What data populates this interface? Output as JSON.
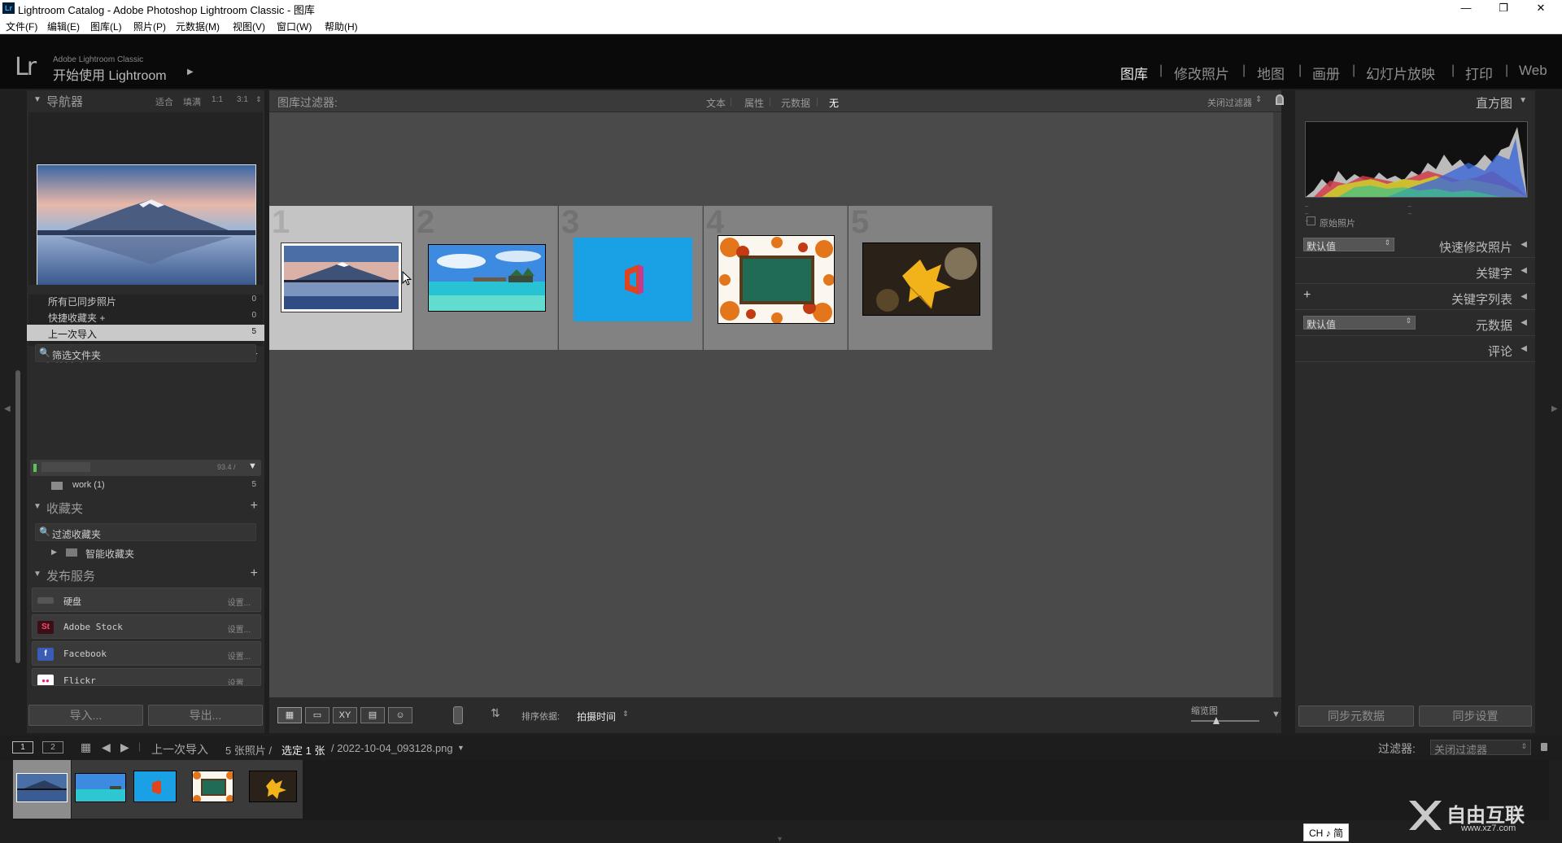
{
  "window": {
    "title": "Lightroom Catalog - Adobe Photoshop Lightroom Classic - 图库",
    "app_icon": "Lr"
  },
  "menu": [
    "文件(F)",
    "编辑(E)",
    "图库(L)",
    "照片(P)",
    "元数据(M)",
    "视图(V)",
    "窗口(W)",
    "帮助(H)"
  ],
  "identity": {
    "logo": "Lr",
    "sub": "Adobe Lightroom Classic",
    "main": "开始使用 Lightroom",
    "arrow": "▶"
  },
  "modules": [
    "图库",
    "修改照片",
    "地图",
    "画册",
    "幻灯片放映",
    "打印",
    "Web"
  ],
  "navigator": {
    "title": "导航器",
    "zoom": [
      "适合",
      "填满",
      "1:1",
      "3:1"
    ]
  },
  "catalog": {
    "rows": [
      {
        "label": "所有已同步照片",
        "count": "0"
      },
      {
        "label": "快捷收藏夹 +",
        "count": "0"
      },
      {
        "label": "上一次导入",
        "count": "5"
      }
    ]
  },
  "folders": {
    "title": "文件夹",
    "filter": "筛选文件夹",
    "volume": {
      "name": "",
      "size": "93.4 /"
    },
    "items": [
      {
        "label": "work (1)",
        "count": "5"
      }
    ]
  },
  "collections": {
    "title": "收藏夹",
    "filter": "过滤收藏夹",
    "smart": "智能收藏夹"
  },
  "publish": {
    "title": "发布服务",
    "services": [
      {
        "name": "硬盘",
        "setting": "设置...",
        "icon": "drive-icon"
      },
      {
        "name": "Adobe Stock",
        "setting": "设置...",
        "icon": "adobe-stock-icon",
        "badge": "St"
      },
      {
        "name": "Facebook",
        "setting": "设置...",
        "icon": "facebook-icon",
        "badge": "f"
      },
      {
        "name": "Flickr",
        "setting": "设置...",
        "icon": "flickr-icon",
        "badge": "●●"
      }
    ]
  },
  "left_buttons": {
    "import": "导入...",
    "export": "导出..."
  },
  "filter_bar": {
    "label": "图库过滤器:",
    "tabs": [
      "文本",
      "属性",
      "元数据",
      "无"
    ],
    "preset": "关闭过滤器"
  },
  "grid": {
    "numbers": [
      "1",
      "2",
      "3",
      "4",
      "5"
    ]
  },
  "toolbar": {
    "sort_label": "排序依据:",
    "sort_value": "拍摄时间",
    "thumb_label": "缩览图"
  },
  "right": {
    "histogram": "直方图",
    "original": "原始照片",
    "quick_develop": {
      "preset": "默认值",
      "label": "快速修改照片"
    },
    "keywords": "关键字",
    "keyword_list": "关键字列表",
    "metadata": {
      "preset": "默认值",
      "label": "元数据"
    },
    "comments": "评论",
    "sync_metadata": "同步元数据",
    "sync_settings": "同步设置"
  },
  "filmstrip_bar": {
    "screens": [
      "1",
      "2"
    ],
    "path": "上一次导入",
    "count": "5 张照片 /",
    "selected": "选定 1 张",
    "file": "/ 2022-10-04_093128.png",
    "filter_label": "过滤器:",
    "filter_value": "关闭过滤器"
  },
  "ime": "CH ♪ 简",
  "watermark": {
    "brand": "自由互联",
    "url": "www.xz7.com"
  }
}
